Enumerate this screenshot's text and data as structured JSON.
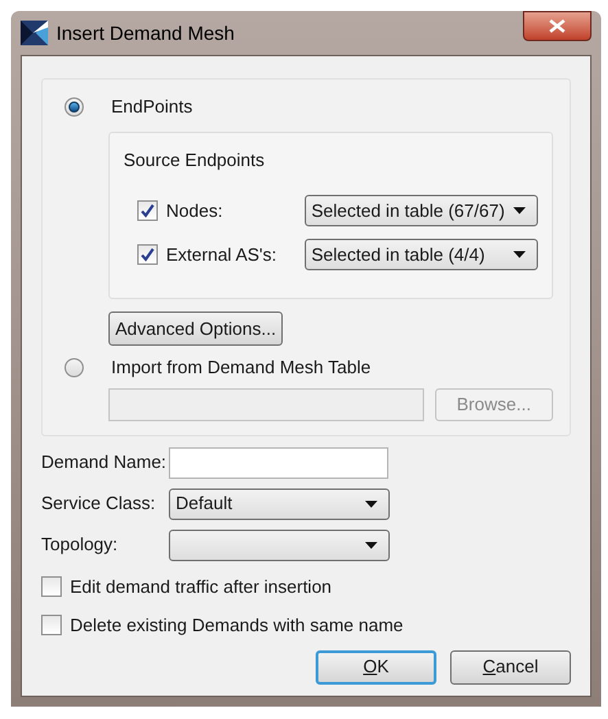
{
  "window": {
    "title": "Insert Demand Mesh"
  },
  "source_options": [
    {
      "label": "EndPoints",
      "selected": true
    },
    {
      "label": "Import from Demand Mesh Table",
      "selected": false
    }
  ],
  "source_endpoints": {
    "title": "Source Endpoints",
    "rows": [
      {
        "label": "Nodes:",
        "checked": true,
        "value": "Selected in table (67/67)"
      },
      {
        "label": "External AS's:",
        "checked": true,
        "value": "Selected in table (4/4)"
      }
    ]
  },
  "advanced_button": "Advanced Options...",
  "import_browse": {
    "button": "Browse...",
    "disabled": true
  },
  "form": [
    {
      "kind": "text",
      "label": "Demand Name:"
    },
    {
      "kind": "dropdown",
      "label": "Service Class:",
      "value": "Default"
    },
    {
      "kind": "dropdown",
      "label": "Topology:"
    }
  ],
  "checkboxes": [
    {
      "label": "Edit demand traffic after insertion",
      "checked": false
    },
    {
      "label": "Delete existing Demands with same name",
      "checked": false
    }
  ],
  "buttons": [
    {
      "access_key": "O",
      "label_rest": "K",
      "default": true
    },
    {
      "access_key": "C",
      "label_rest": "ancel",
      "default": false
    }
  ]
}
